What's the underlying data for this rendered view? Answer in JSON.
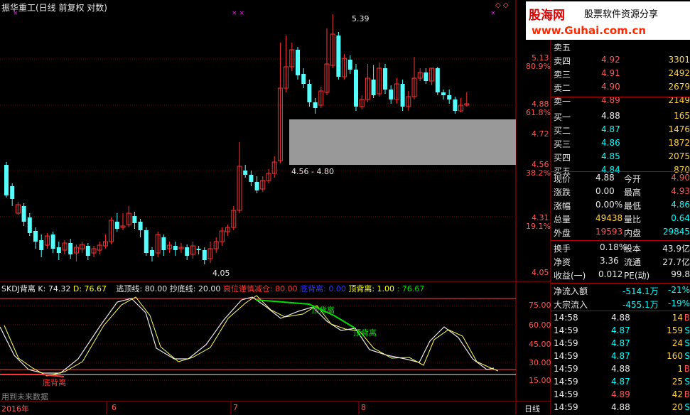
{
  "title": "振华重工(日线 前复权 对数)",
  "banner": {
    "cn": "股海网",
    "slogan": "股票软件资源分享",
    "url": "www.Guhai.com.cn"
  },
  "main": {
    "price_labels": [
      "5.13",
      "80.9%",
      "4.88",
      "61.8%",
      "4.72",
      "4.56",
      "38.2%",
      "4.31",
      "19.1%",
      "4.05"
    ],
    "ann_high": "5.39",
    "ann_range": "4.56 - 4.80",
    "ann_low": "4.05"
  },
  "indicator": {
    "name": "SKDJ背离",
    "k": "K: 74.32",
    "d": "D: 76.67",
    "escape": "逃顶线: 80.00",
    "bottom": "抄底线: 20.00",
    "caution": "高位谨慎减仓: 80.00",
    "divb": "底背离: 0.00",
    "divt": "顶背离: 1.00",
    "last": ": 76.67",
    "levels": [
      "75.00",
      "60.00",
      "45.00",
      "30.00",
      "15.00"
    ],
    "sig_top1": "顶背离",
    "sig_top2": "顶背离",
    "sig_bottom": "底背离",
    "future": "用到未来数据"
  },
  "xaxis": {
    "labels": [
      "2016年",
      "6",
      "7",
      "8"
    ],
    "period": "日线"
  },
  "orders": [
    {
      "label": "卖五",
      "price": "",
      "vol": ""
    },
    {
      "label": "卖四",
      "price": "4.92",
      "vol": "3301"
    },
    {
      "label": "卖三",
      "price": "4.91",
      "vol": "2492"
    },
    {
      "label": "卖二",
      "price": "4.90",
      "vol": "2679"
    },
    {
      "label": "卖一",
      "price": "4.89",
      "vol": "2149"
    },
    {
      "label": "买一",
      "price": "4.88",
      "vol": "165"
    },
    {
      "label": "买二",
      "price": "4.87",
      "vol": "1476"
    },
    {
      "label": "买三",
      "price": "4.86",
      "vol": "1872"
    },
    {
      "label": "买四",
      "price": "4.85",
      "vol": "2075"
    },
    {
      "label": "买五",
      "price": "4.84",
      "vol": "870"
    }
  ],
  "stats": [
    {
      "l1": "现价",
      "v1": "4.88",
      "l2": "今开",
      "v2": "4.90"
    },
    {
      "l1": "涨跌",
      "v1": "0.00",
      "l2": "最高",
      "v2": "4.93"
    },
    {
      "l1": "涨幅",
      "v1": "0.00%",
      "l2": "最低",
      "v2": "4.86"
    },
    {
      "l1": "总量",
      "v1": "49438",
      "l2": "量比",
      "v2": "0.64"
    },
    {
      "l1": "外盘",
      "v1": "19593",
      "l2": "内盘",
      "v2": "29845"
    }
  ],
  "stats2": [
    {
      "l1": "换手",
      "v1": "0.18%",
      "l2": "股本",
      "v2": "43.9亿"
    },
    {
      "l1": "净资",
      "v1": "3.36",
      "l2": "流通",
      "v2": "27.7亿"
    },
    {
      "l1": "收益(一)",
      "v1": "0.012",
      "l2": "PE(动)",
      "v2": "99.8"
    }
  ],
  "flow": [
    {
      "label": "净流入额",
      "value": "-514.1万",
      "pct": "-21%"
    },
    {
      "label": "大宗流入",
      "value": "-455.1万",
      "pct": "-19%"
    }
  ],
  "ticks": [
    {
      "time": "14:58",
      "price": "4.88",
      "vol": "14",
      "dir": "B"
    },
    {
      "time": "14:59",
      "price": "4.87",
      "vol": "159",
      "dir": "S"
    },
    {
      "time": "14:59",
      "price": "4.87",
      "vol": "24",
      "dir": "S"
    },
    {
      "time": "14:59",
      "price": "4.87",
      "vol": "160",
      "dir": "S"
    },
    {
      "time": "14:59",
      "price": "4.88",
      "vol": "1",
      "dir": "B"
    },
    {
      "time": "14:59",
      "price": "4.87",
      "vol": "25",
      "dir": "S"
    },
    {
      "time": "14:59",
      "price": "4.89",
      "vol": "42",
      "dir": "B"
    },
    {
      "time": "14:59",
      "price": "4.88",
      "vol": "20",
      "dir": "S"
    }
  ],
  "colors": {
    "up": "#ff3333",
    "down": "#54ffff",
    "grid": "#8b0000",
    "border": "#b00000"
  }
}
